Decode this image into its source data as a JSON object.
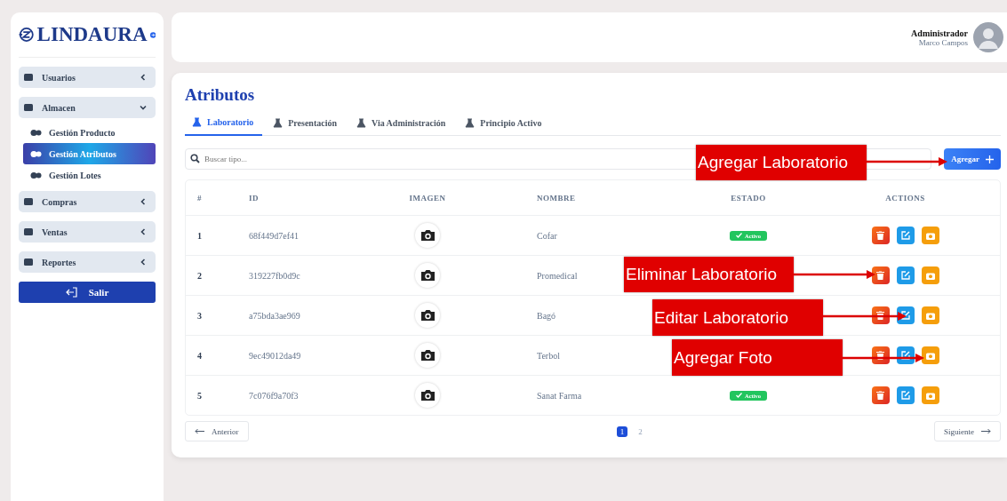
{
  "sidebar": {
    "logo": "LINDAURA",
    "menu": [
      {
        "label": "Usuarios",
        "expanded": false
      },
      {
        "label": "Almacen",
        "expanded": true,
        "children": [
          {
            "label": "Gestión Producto",
            "selected": false
          },
          {
            "label": "Gestión Atributos",
            "selected": true
          },
          {
            "label": "Gestión Lotes",
            "selected": false
          }
        ]
      },
      {
        "label": "Compras",
        "expanded": false
      },
      {
        "label": "Ventas",
        "expanded": false
      },
      {
        "label": "Reportes",
        "expanded": false
      }
    ],
    "logout": "Salir"
  },
  "header": {
    "role": "Administrador",
    "user": "Marco Campos"
  },
  "page": {
    "title": "Atributos",
    "tabs": [
      {
        "label": "Laboratorio",
        "selected": true
      },
      {
        "label": "Presentación",
        "selected": false
      },
      {
        "label": "Via Administración",
        "selected": false
      },
      {
        "label": "Principio Activo",
        "selected": false
      }
    ],
    "search": {
      "placeholder": "Buscar tipo..."
    },
    "add_button": "Agregar",
    "table": {
      "columns": [
        "#",
        "ID",
        "IMAGEN",
        "NOMBRE",
        "ESTADO",
        "ACTIONS"
      ],
      "rows": [
        {
          "n": "1",
          "id": "68f449d7ef41",
          "nombre": "Cofar",
          "estado": "Activo"
        },
        {
          "n": "2",
          "id": "319227fb0d9c",
          "nombre": "Promedical"
        },
        {
          "n": "3",
          "id": "a75bda3ae969",
          "nombre": "Bagó"
        },
        {
          "n": "4",
          "id": "9ec49012da49",
          "nombre": "Terbol"
        },
        {
          "n": "5",
          "id": "7c076f9a70f3",
          "nombre": "Sanat Farma",
          "estado": "Activo"
        }
      ]
    },
    "pagination": {
      "previous": "Anterior",
      "pages": [
        {
          "label": "1",
          "selected": true
        },
        {
          "label": "2",
          "selected": false
        }
      ],
      "next": "Siguiente"
    }
  },
  "annotations": [
    "Agregar Laboratorio",
    "Eliminar Laboratorio",
    "Editar Laboratorio",
    "Agregar Foto"
  ]
}
